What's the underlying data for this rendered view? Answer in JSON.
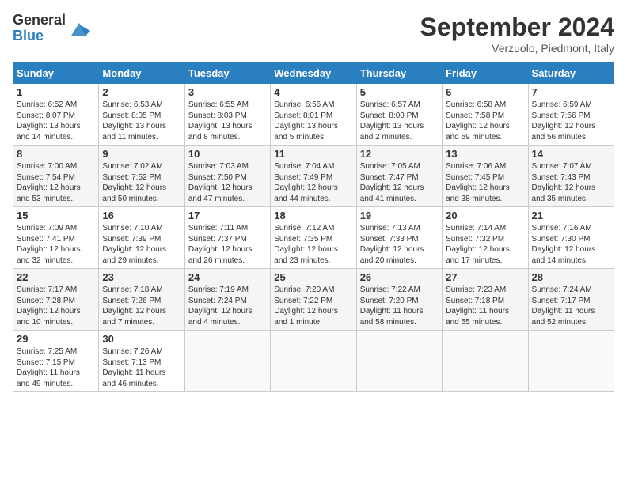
{
  "logo": {
    "general": "General",
    "blue": "Blue"
  },
  "title": {
    "month": "September 2024",
    "location": "Verzuolo, Piedmont, Italy"
  },
  "headers": [
    "Sunday",
    "Monday",
    "Tuesday",
    "Wednesday",
    "Thursday",
    "Friday",
    "Saturday"
  ],
  "weeks": [
    [
      {
        "day": "1",
        "info": "Sunrise: 6:52 AM\nSunset: 8:07 PM\nDaylight: 13 hours\nand 14 minutes."
      },
      {
        "day": "2",
        "info": "Sunrise: 6:53 AM\nSunset: 8:05 PM\nDaylight: 13 hours\nand 11 minutes."
      },
      {
        "day": "3",
        "info": "Sunrise: 6:55 AM\nSunset: 8:03 PM\nDaylight: 13 hours\nand 8 minutes."
      },
      {
        "day": "4",
        "info": "Sunrise: 6:56 AM\nSunset: 8:01 PM\nDaylight: 13 hours\nand 5 minutes."
      },
      {
        "day": "5",
        "info": "Sunrise: 6:57 AM\nSunset: 8:00 PM\nDaylight: 13 hours\nand 2 minutes."
      },
      {
        "day": "6",
        "info": "Sunrise: 6:58 AM\nSunset: 7:58 PM\nDaylight: 12 hours\nand 59 minutes."
      },
      {
        "day": "7",
        "info": "Sunrise: 6:59 AM\nSunset: 7:56 PM\nDaylight: 12 hours\nand 56 minutes."
      }
    ],
    [
      {
        "day": "8",
        "info": "Sunrise: 7:00 AM\nSunset: 7:54 PM\nDaylight: 12 hours\nand 53 minutes."
      },
      {
        "day": "9",
        "info": "Sunrise: 7:02 AM\nSunset: 7:52 PM\nDaylight: 12 hours\nand 50 minutes."
      },
      {
        "day": "10",
        "info": "Sunrise: 7:03 AM\nSunset: 7:50 PM\nDaylight: 12 hours\nand 47 minutes."
      },
      {
        "day": "11",
        "info": "Sunrise: 7:04 AM\nSunset: 7:49 PM\nDaylight: 12 hours\nand 44 minutes."
      },
      {
        "day": "12",
        "info": "Sunrise: 7:05 AM\nSunset: 7:47 PM\nDaylight: 12 hours\nand 41 minutes."
      },
      {
        "day": "13",
        "info": "Sunrise: 7:06 AM\nSunset: 7:45 PM\nDaylight: 12 hours\nand 38 minutes."
      },
      {
        "day": "14",
        "info": "Sunrise: 7:07 AM\nSunset: 7:43 PM\nDaylight: 12 hours\nand 35 minutes."
      }
    ],
    [
      {
        "day": "15",
        "info": "Sunrise: 7:09 AM\nSunset: 7:41 PM\nDaylight: 12 hours\nand 32 minutes."
      },
      {
        "day": "16",
        "info": "Sunrise: 7:10 AM\nSunset: 7:39 PM\nDaylight: 12 hours\nand 29 minutes."
      },
      {
        "day": "17",
        "info": "Sunrise: 7:11 AM\nSunset: 7:37 PM\nDaylight: 12 hours\nand 26 minutes."
      },
      {
        "day": "18",
        "info": "Sunrise: 7:12 AM\nSunset: 7:35 PM\nDaylight: 12 hours\nand 23 minutes."
      },
      {
        "day": "19",
        "info": "Sunrise: 7:13 AM\nSunset: 7:33 PM\nDaylight: 12 hours\nand 20 minutes."
      },
      {
        "day": "20",
        "info": "Sunrise: 7:14 AM\nSunset: 7:32 PM\nDaylight: 12 hours\nand 17 minutes."
      },
      {
        "day": "21",
        "info": "Sunrise: 7:16 AM\nSunset: 7:30 PM\nDaylight: 12 hours\nand 14 minutes."
      }
    ],
    [
      {
        "day": "22",
        "info": "Sunrise: 7:17 AM\nSunset: 7:28 PM\nDaylight: 12 hours\nand 10 minutes."
      },
      {
        "day": "23",
        "info": "Sunrise: 7:18 AM\nSunset: 7:26 PM\nDaylight: 12 hours\nand 7 minutes."
      },
      {
        "day": "24",
        "info": "Sunrise: 7:19 AM\nSunset: 7:24 PM\nDaylight: 12 hours\nand 4 minutes."
      },
      {
        "day": "25",
        "info": "Sunrise: 7:20 AM\nSunset: 7:22 PM\nDaylight: 12 hours\nand 1 minute."
      },
      {
        "day": "26",
        "info": "Sunrise: 7:22 AM\nSunset: 7:20 PM\nDaylight: 11 hours\nand 58 minutes."
      },
      {
        "day": "27",
        "info": "Sunrise: 7:23 AM\nSunset: 7:18 PM\nDaylight: 11 hours\nand 55 minutes."
      },
      {
        "day": "28",
        "info": "Sunrise: 7:24 AM\nSunset: 7:17 PM\nDaylight: 11 hours\nand 52 minutes."
      }
    ],
    [
      {
        "day": "29",
        "info": "Sunrise: 7:25 AM\nSunset: 7:15 PM\nDaylight: 11 hours\nand 49 minutes."
      },
      {
        "day": "30",
        "info": "Sunrise: 7:26 AM\nSunset: 7:13 PM\nDaylight: 11 hours\nand 46 minutes."
      },
      {
        "day": "",
        "info": ""
      },
      {
        "day": "",
        "info": ""
      },
      {
        "day": "",
        "info": ""
      },
      {
        "day": "",
        "info": ""
      },
      {
        "day": "",
        "info": ""
      }
    ]
  ]
}
